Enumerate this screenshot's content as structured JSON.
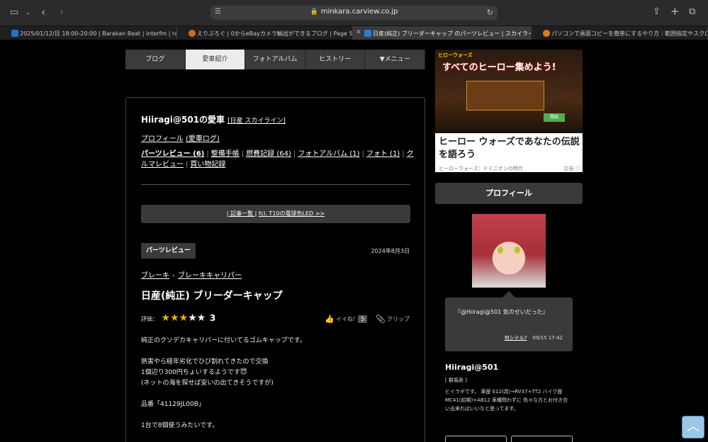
{
  "browser": {
    "url": "minkara.carview.co.jp",
    "tabs": [
      {
        "label": "2025/01/12/日 18:00-20:00 | Barakan Beat | interfm | radiko",
        "color": "#1e74c8"
      },
      {
        "label": "えりぷろぐ | 0からeBayカメラ輸出ができるブログ | Page 5 of 7",
        "color": "#d2691e"
      },
      {
        "label": "日産(純正) ブリーダーキャップ のパーツレビュー | スカイライン(Hi...",
        "color": "#2a7bd6"
      },
      {
        "label": "パソコンで画面コピーを簡単にするやり方｜範囲指定やスクロール...",
        "color": "#e07a1a"
      }
    ]
  },
  "nav": [
    "ブログ",
    "愛車紹介",
    "フォトアルバム",
    "ヒストリー",
    "▼メニュー"
  ],
  "header": {
    "owner": "Hiiragi@501の愛車",
    "car_link": "[日産 スカイライン]",
    "profile_link": "プロフィール",
    "car_log_link": "(愛車ログ)"
  },
  "sublinks": [
    {
      "label": "パーツレビュー (6)",
      "bold": true
    },
    {
      "label": "整備手帳"
    },
    {
      "label": "燃費記録 (64)"
    },
    {
      "label": "フォトアルバム (1)"
    },
    {
      "label": "フォト (1)"
    },
    {
      "label": "クルマレビュー"
    },
    {
      "label": "買い物記録"
    }
  ],
  "pager": {
    "list": "| 記事一覧 |",
    "next": "fcl. T10の電球色LED >>"
  },
  "article": {
    "badge": "パーツレビュー",
    "date": "2024年8月3日",
    "crumb1": "ブレーキ",
    "crumb2": "ブレーキキャリパー",
    "title": "日産(純正) ブリーダーキャップ",
    "rating_label": "評価：",
    "rating": 3,
    "rating_text": "3",
    "like_label": "イイね!",
    "like_count": "5",
    "clip_label": "クリップ",
    "body": [
      "純正のクソデカキャリパーに付いてるゴムキャップです。",
      "",
      "熱害やら経年劣化でひび割れてきたので交換",
      "1個辺り300円ちょいするようです😇",
      "(ネットの海を探せば安いの出てきそうですが)",
      "",
      "品番「41129JL00B」",
      "",
      "1台で8個使うみたいです。"
    ]
  },
  "ad": {
    "logo": "ヒローウォーズ",
    "banner": "すべてのヒーロー集めよう!",
    "button": "開始",
    "title": "ヒーロー ウォーズであなたの伝説を語ろう",
    "source": "ヒーローウォーズ：ドミニオンの時代",
    "tag": "広告 ⓘ"
  },
  "profile": {
    "heading": "プロフィール",
    "bubble": "『@Hiiragi@501 気のせいだった』",
    "bubble_link": "何シテル?",
    "bubble_time": "09/15 17:42",
    "name": "Hiiragi@501",
    "pref": "[ 群馬県 ]",
    "bio": "ヒイラギです。 車歴 E12(改)→RV37+TT2 バイク歴 MC41(前期)+AB12 車種問わずに 色々な方とお付き合い出来ればいいなと思ってます。"
  },
  "scroll_top_icon": "chevron-up-icon"
}
